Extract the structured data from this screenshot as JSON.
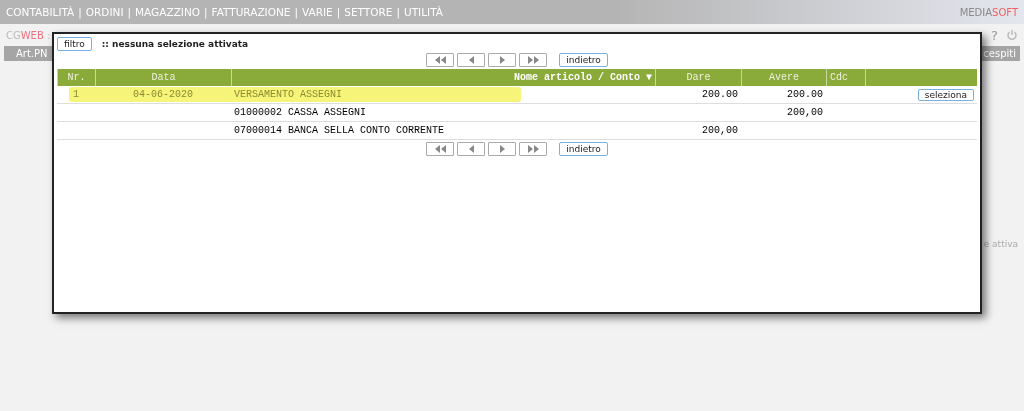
{
  "menu": [
    "CONTABILITÀ",
    "ORDINI",
    "MAGAZZINO",
    "FATTURAZIONE",
    "VARIE",
    "SETTORE",
    "UTILITÀ"
  ],
  "menu_separator": "|",
  "help_icon": "?",
  "brand": {
    "part_1": "MEDIA",
    "part_2": "SOFT"
  },
  "app_label": {
    "part_1": "CG",
    "part_2": "WEB",
    "suffix": ":"
  },
  "tabs": [
    {
      "label": "Art.PN"
    },
    {
      "label": "cespiti"
    }
  ],
  "background_text": "e attiva",
  "dialog": {
    "filter_button": "filtro",
    "filter_status": ":: nessuna selezione attivata",
    "back_button_top": "indietro",
    "back_button_bottom": "indietro",
    "columns": [
      "Nr.",
      "Data",
      "Nome articolo / Conto ▼",
      "Dare",
      "Avere",
      "Cdc"
    ],
    "rows": [
      {
        "nr": "1",
        "date": "04-06-2020",
        "name": "VERSAMENTO ASSEGNI",
        "dare": "200.00",
        "avere": "200.00",
        "highlighted": true,
        "action": "seleziona"
      },
      {
        "name": "01000002 CASSA ASSEGNI",
        "avere": "200,00",
        "highlighted": false
      },
      {
        "name": "07000014 BANCA SELLA CONTO CORRENTE",
        "dare": "200,00",
        "highlighted": false
      }
    ]
  }
}
